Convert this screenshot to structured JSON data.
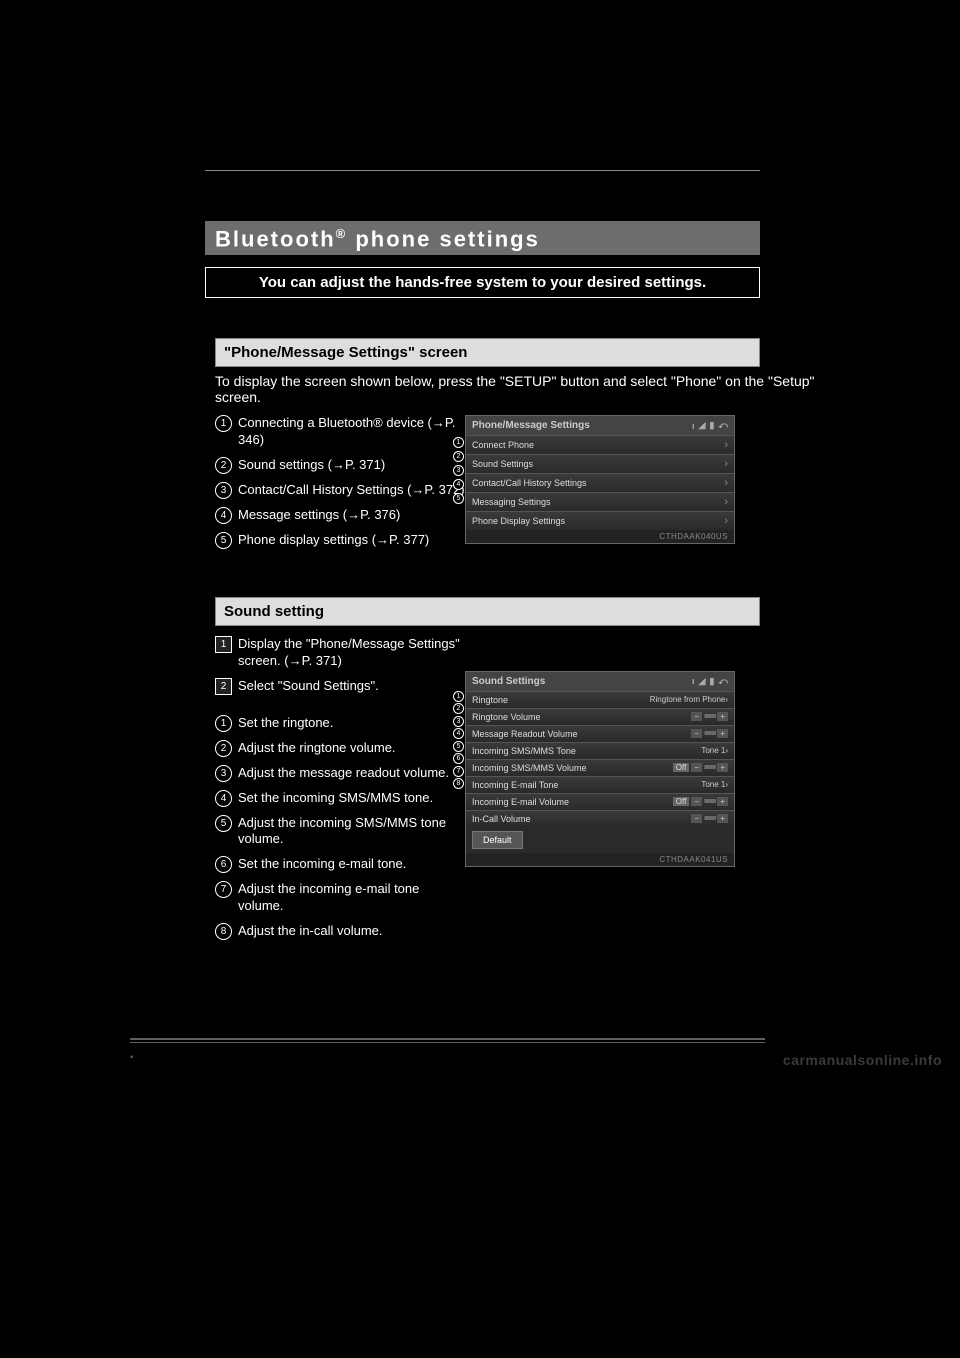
{
  "title": {
    "prefix": "Bluetooth",
    "sup": "®",
    "suffix": " phone settings"
  },
  "banner": "You can adjust the hands-free system to your desired settings.",
  "section1": {
    "heading": "\"Phone/Message Settings\" screen",
    "intro": "To display the screen shown below, press the \"SETUP\" button and select \"Phone\" on the \"Setup\" screen.",
    "items": [
      "Connecting a Bluetooth® device (→P. 346)",
      "Sound settings (→P. 371)",
      "Contact/Call History Settings (→P. 372)",
      "Message settings (→P. 376)",
      "Phone display settings (→P. 377)"
    ],
    "screenshot": {
      "header": "Phone/Message Settings",
      "rows": [
        "Connect Phone",
        "Sound Settings",
        "Contact/Call History Settings",
        "Messaging Settings",
        "Phone Display Settings"
      ],
      "caption": "CTHDAAK040US"
    }
  },
  "section2": {
    "heading": "Sound setting",
    "steps": [
      "Display the \"Phone/Message Settings\" screen. (→P. 371)",
      "Select \"Sound Settings\"."
    ],
    "items": [
      "Set the ringtone.",
      "Adjust the ringtone volume.",
      "Adjust the message readout volume.",
      "Set the incoming SMS/MMS tone.",
      "Adjust the incoming SMS/MMS tone volume.",
      "Set the incoming e-mail tone.",
      "Adjust the incoming e-mail tone volume.",
      "Adjust the in-call volume."
    ],
    "screenshot": {
      "header": "Sound Settings",
      "rows": [
        {
          "label": "Ringtone",
          "value": "Ringtone from Phone›"
        },
        {
          "label": "Ringtone Volume",
          "value": "slider"
        },
        {
          "label": "Message Readout Volume",
          "value": "slider"
        },
        {
          "label": "Incoming SMS/MMS Tone",
          "value": "Tone 1›"
        },
        {
          "label": "Incoming SMS/MMS Volume",
          "value": "offslider"
        },
        {
          "label": "Incoming E-mail Tone",
          "value": "Tone 1›"
        },
        {
          "label": "Incoming E-mail Volume",
          "value": "offslider"
        },
        {
          "label": "In-Call Volume",
          "value": "slider"
        }
      ],
      "default": "Default",
      "caption": "CTHDAAK041US"
    }
  },
  "watermark": "carmanualsonline.info"
}
